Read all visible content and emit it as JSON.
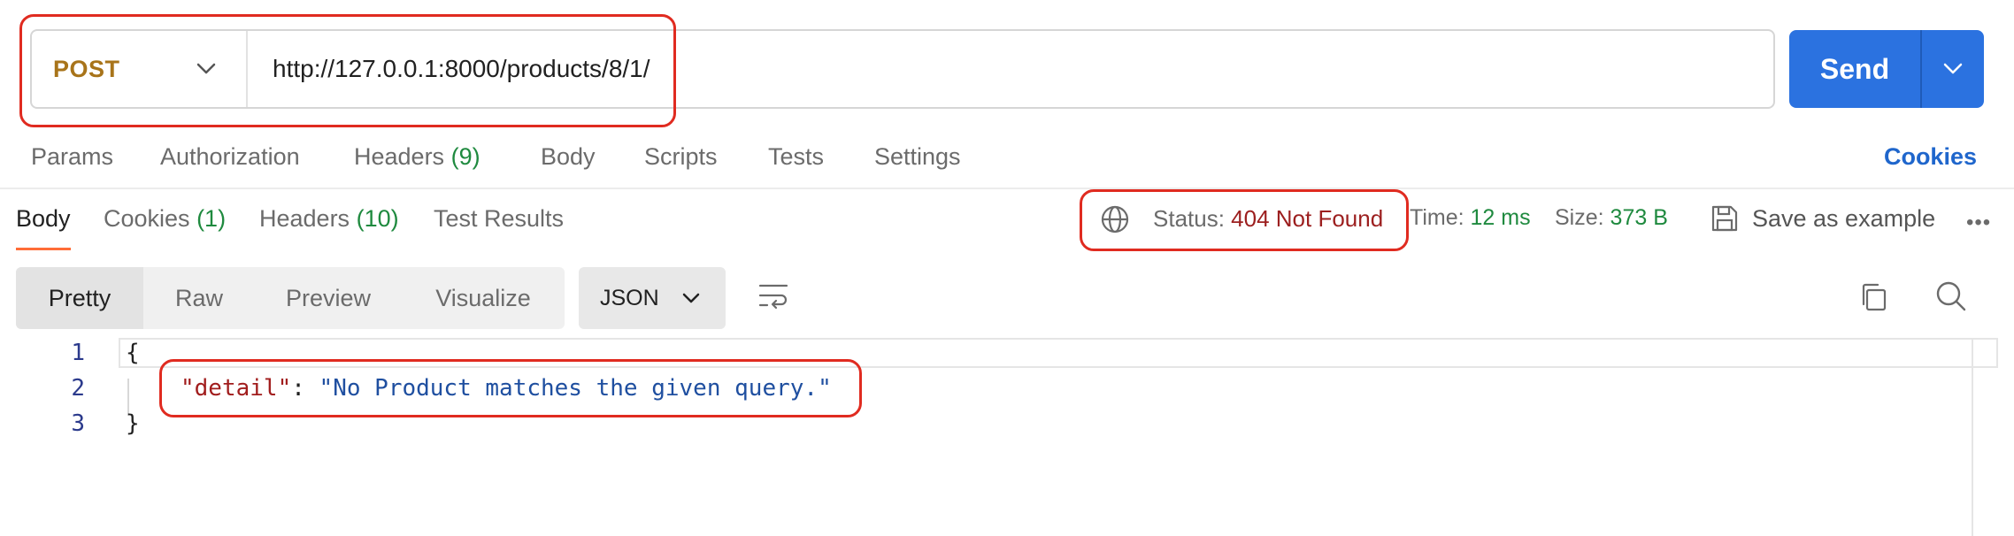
{
  "request": {
    "method": "POST",
    "url": "http://127.0.0.1:8000/products/8/1/",
    "send_label": "Send"
  },
  "request_tabs": {
    "params": "Params",
    "authorization": "Authorization",
    "headers": "Headers",
    "headers_count": "(9)",
    "body": "Body",
    "scripts": "Scripts",
    "tests": "Tests",
    "settings": "Settings",
    "cookies": "Cookies"
  },
  "response_tabs": {
    "body": "Body",
    "cookies": "Cookies",
    "cookies_count": "(1)",
    "headers": "Headers",
    "headers_count": "(10)",
    "test_results": "Test Results"
  },
  "response_meta": {
    "status_label": "Status:",
    "status_value": "404 Not Found",
    "time_label": "Time:",
    "time_value": "12 ms",
    "size_label": "Size:",
    "size_value": "373 B",
    "save_label": "Save as example",
    "more": "•••"
  },
  "view_modes": [
    "Pretty",
    "Raw",
    "Preview",
    "Visualize"
  ],
  "format": "JSON",
  "code": {
    "line_numbers": [
      "1",
      "2",
      "3"
    ],
    "open_brace": "{",
    "key": "\"detail\"",
    "colon": ": ",
    "value": "\"No Product matches the given query.\"",
    "close_brace": "}"
  },
  "colors": {
    "accent": "#2b72e0",
    "method": "#a8741a",
    "status_error": "#9c1f1f",
    "ok_green": "#1f8a3f",
    "annotation": "#e02b20"
  },
  "icons": [
    "chevron-down-icon",
    "globe-icon",
    "save-icon",
    "wrap-lines-icon",
    "copy-icon",
    "search-icon",
    "more-icon"
  ]
}
